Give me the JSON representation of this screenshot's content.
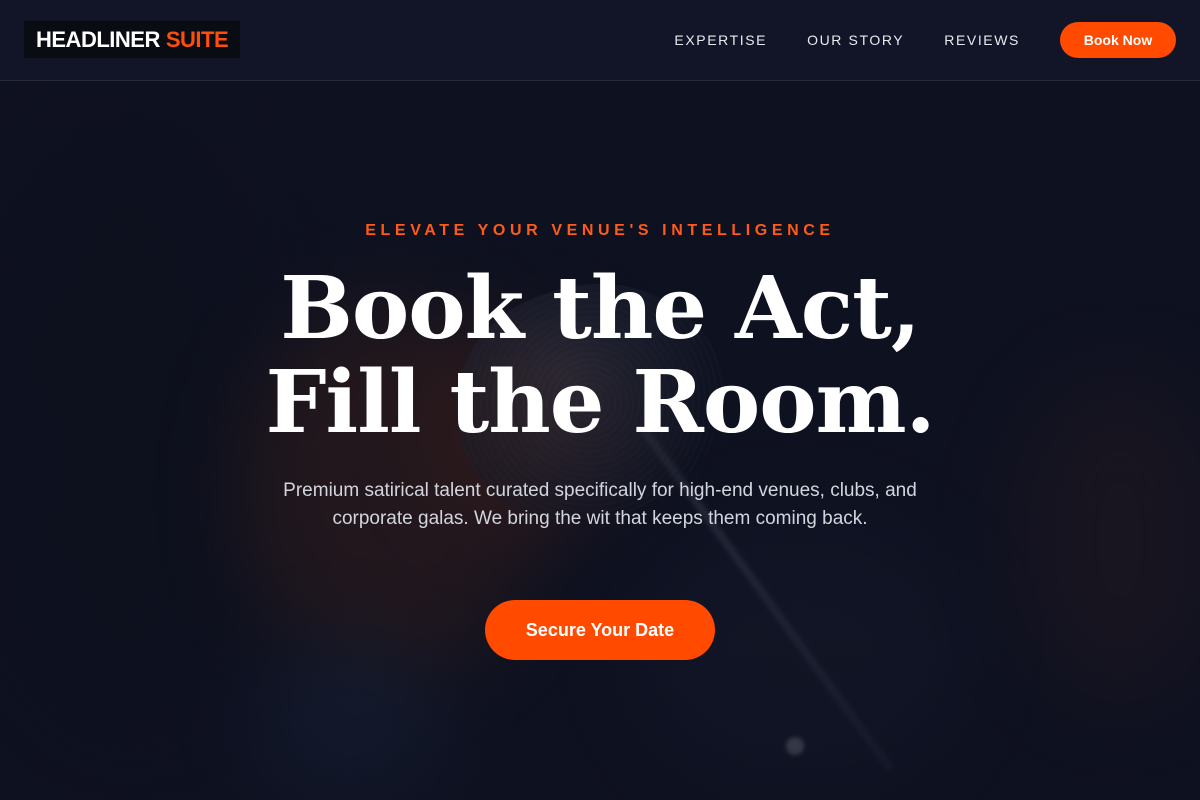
{
  "brand": {
    "name_primary": "HEADLINER",
    "name_accent": "SUITE",
    "accent_color": "#ff4a00"
  },
  "nav": {
    "links": [
      {
        "label": "EXPERTISE"
      },
      {
        "label": "OUR STORY"
      },
      {
        "label": "REVIEWS"
      }
    ],
    "cta_label": "Book Now"
  },
  "hero": {
    "eyebrow": "ELEVATE YOUR VENUE'S INTELLIGENCE",
    "headline_line1": "Book the Act,",
    "headline_line2": "Fill the Room.",
    "subtext": "Premium satirical talent curated specifically for high-end venues, clubs, and corporate galas. We bring the wit that keeps them coming back.",
    "cta_label": "Secure Your Date",
    "background_image": "microphone-photo"
  },
  "colors": {
    "background": "#0e1120",
    "header_background": "#121528",
    "accent": "#ff4a00",
    "text": "#ffffff"
  }
}
